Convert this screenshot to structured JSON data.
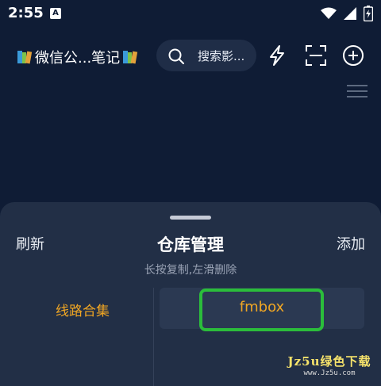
{
  "status": {
    "time": "2:55",
    "app_icon_letter": "A"
  },
  "header": {
    "title": "微信公...笔记",
    "search_placeholder": "搜索影..."
  },
  "sheet": {
    "refresh_label": "刷新",
    "title": "仓库管理",
    "add_label": "添加",
    "hint": "长按复制,左滑删除",
    "categories": [
      "线路合集"
    ],
    "repos": [
      "fmbox"
    ]
  },
  "watermark": {
    "main": "Jz5u绿色下载",
    "url": "www.Jz5u.com"
  },
  "colors": {
    "background": "#0f1c35",
    "sheet": "#222f46",
    "accent": "#f0a623",
    "highlight": "#2bbd3b"
  }
}
